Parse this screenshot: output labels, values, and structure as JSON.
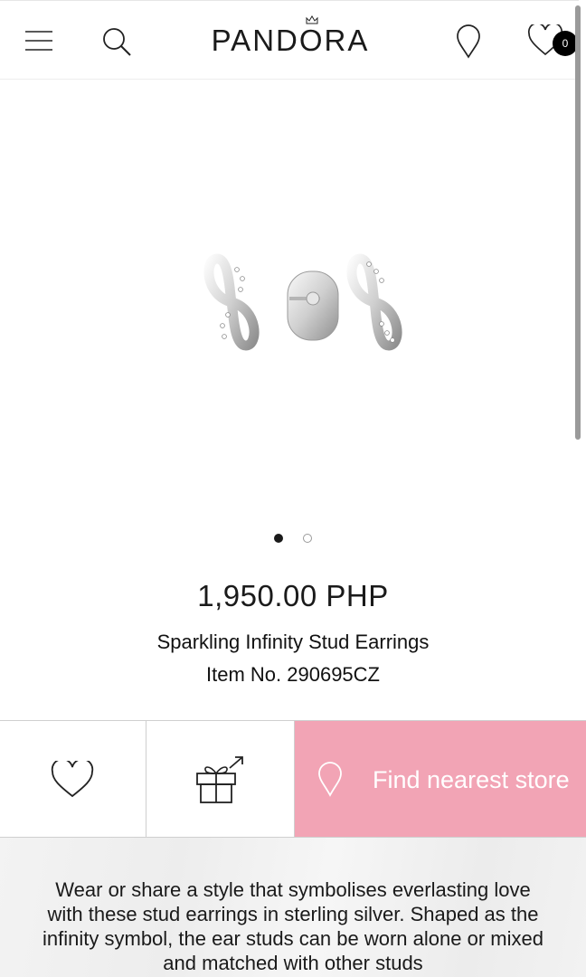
{
  "header": {
    "logo_text": "PANDORA",
    "wishlist_count": "0",
    "icons": [
      "menu-icon",
      "search-icon",
      "store-locator-icon",
      "wishlist-icon"
    ]
  },
  "gallery": {
    "image": "sparkling-infinity-stud-earrings",
    "slide_count": 2,
    "active_slide": 1
  },
  "product": {
    "price": "1,950.00 PHP",
    "name": "Sparkling Infinity Stud Earrings",
    "item_number": "Item No. 290695CZ"
  },
  "actions": {
    "wishlist_icon": "heart-icon",
    "gift_icon": "gift-share-icon",
    "store_label": "Find nearest store"
  },
  "description": {
    "text": "Wear or share a style that symbolises everlasting love with these stud earrings in sterling silver. Shaped as the infinity symbol, the ear studs can be worn alone or mixed and matched with other studs"
  },
  "colors": {
    "accent_pink": "#f2a4b5",
    "text": "#1a1a1a",
    "badge_bg": "#000000"
  }
}
